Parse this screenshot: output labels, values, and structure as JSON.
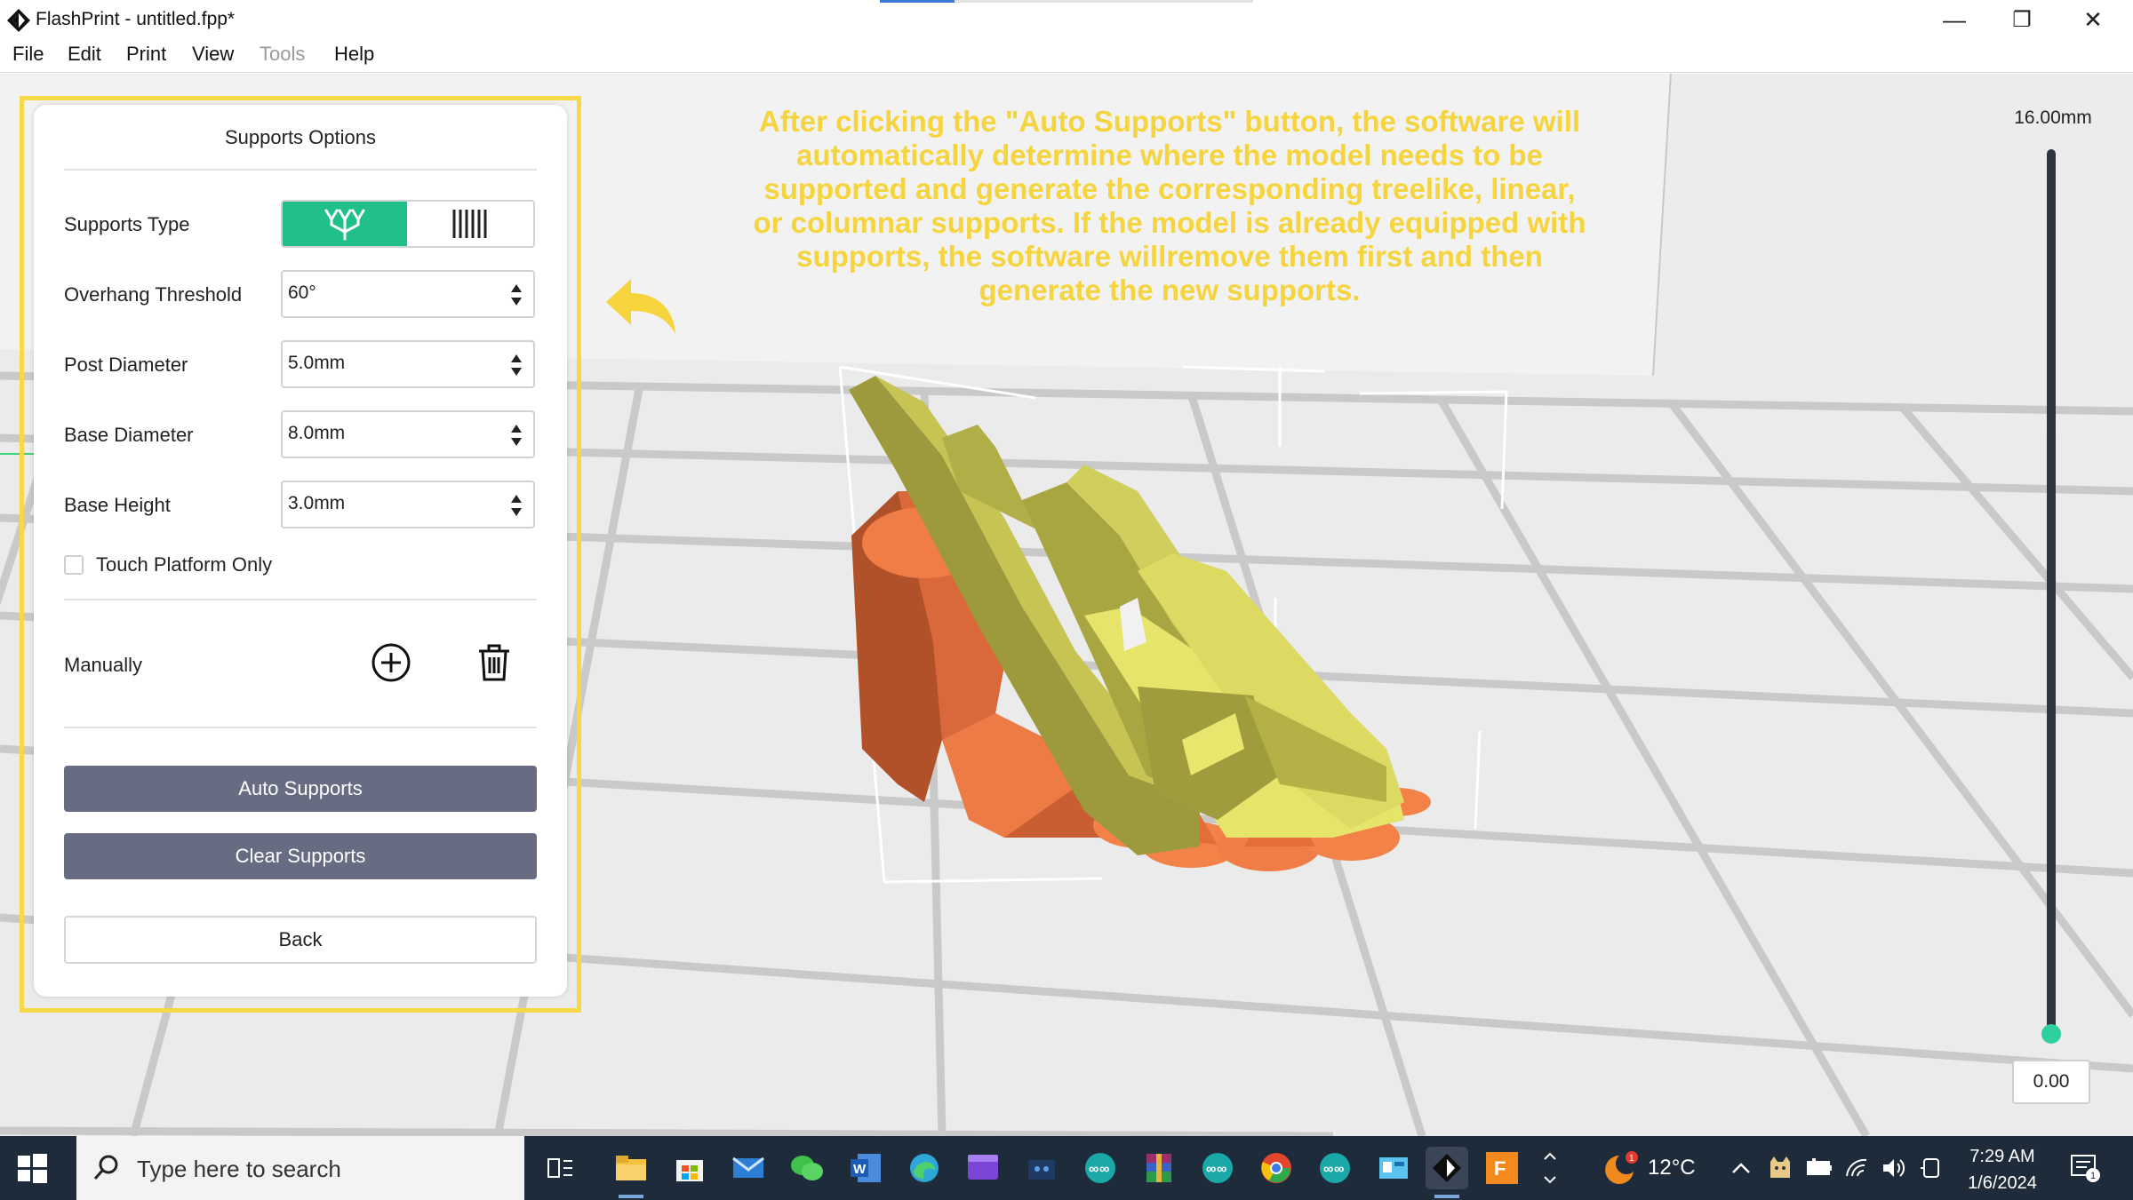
{
  "window": {
    "title": "FlashPrint - untitled.fpp*",
    "controls": {
      "minimize": "—",
      "restore": "❐",
      "close": "✕"
    }
  },
  "menu": [
    "File",
    "Edit",
    "Print",
    "View",
    "Tools",
    "Help"
  ],
  "menu_disabled": [
    "Tools"
  ],
  "panel": {
    "title": "Supports Options",
    "supports_type_label": "Supports Type",
    "supports_type_options": [
      "treelike-icon",
      "linear-icon"
    ],
    "supports_type_selected": "treelike-icon",
    "overhang_label": "Overhang Threshold",
    "overhang_value": "60°",
    "post_diameter_label": "Post Diameter",
    "post_diameter_value": "5.0mm",
    "base_diameter_label": "Base Diameter",
    "base_diameter_value": "8.0mm",
    "base_height_label": "Base Height",
    "base_height_value": "3.0mm",
    "touch_platform_label": "Touch Platform Only",
    "touch_platform_checked": false,
    "manually_label": "Manually",
    "auto_supports": "Auto Supports",
    "clear_supports": "Clear Supports",
    "back": "Back"
  },
  "annotation": "After clicking the \"Auto Supports\" button, the software will automatically determine where the model needs to be supported and generate the corresponding treelike, linear, or columnar supports. If the model is already equipped with supports, the software willremove them first and then generate the new supports.",
  "height_slider": {
    "max_label": "16.00mm",
    "current_value": "0.00",
    "level_fraction": 0
  },
  "taskbar": {
    "search_placeholder": "Type here to search",
    "weather_temp": "12°C",
    "time": "7:29 AM",
    "date": "1/6/2024",
    "notification_count": "1",
    "weather_badge": "1"
  },
  "colors": {
    "accent": "#21c08b",
    "annotation": "#f5d43e",
    "highlight_frame": "#f7d848",
    "model": "#cdcb5a",
    "supports": "#f07d46",
    "button_dark": "#676c83",
    "taskbar": "#1e2b3a"
  }
}
